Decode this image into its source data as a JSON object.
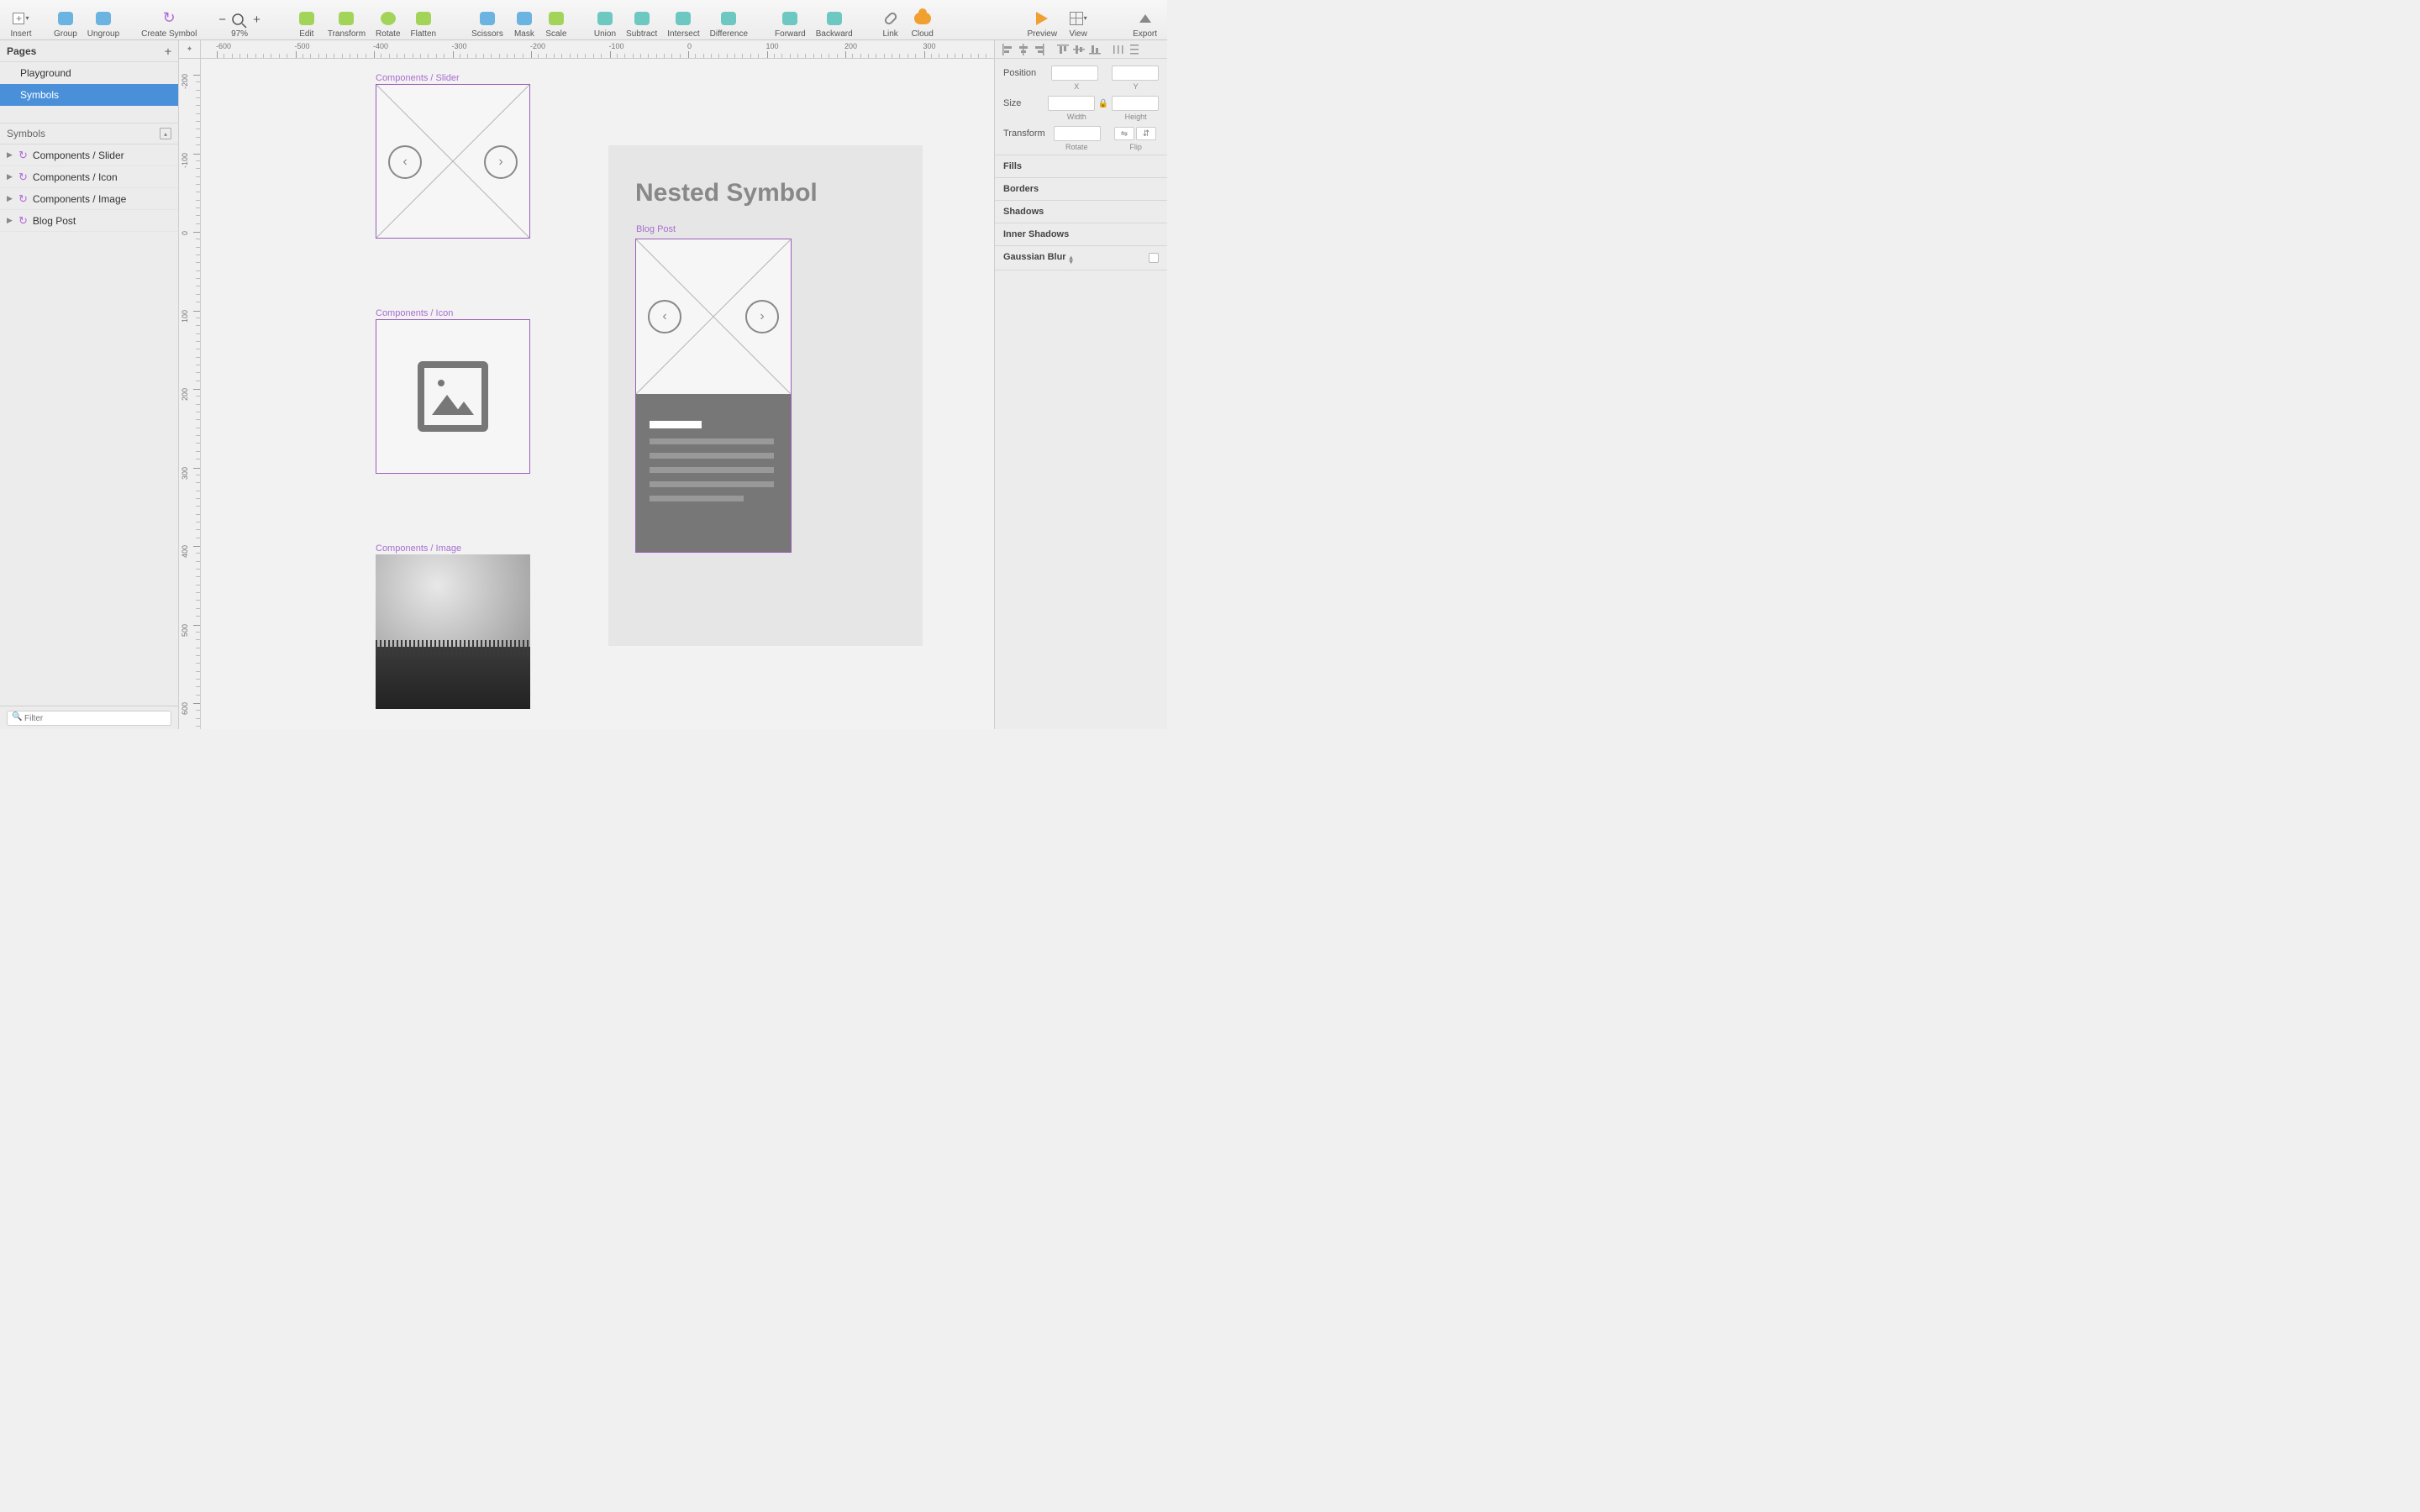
{
  "toolbar": {
    "insert": "Insert",
    "group": "Group",
    "ungroup": "Ungroup",
    "create_symbol": "Create Symbol",
    "zoom": "97%",
    "edit": "Edit",
    "transform": "Transform",
    "rotate": "Rotate",
    "flatten": "Flatten",
    "scissors": "Scissors",
    "mask": "Mask",
    "scale": "Scale",
    "union": "Union",
    "subtract": "Subtract",
    "intersect": "Intersect",
    "difference": "Difference",
    "forward": "Forward",
    "backward": "Backward",
    "link": "Link",
    "cloud": "Cloud",
    "preview": "Preview",
    "view": "View",
    "export": "Export"
  },
  "left": {
    "pages_title": "Pages",
    "pages": [
      {
        "name": "Playground",
        "selected": false
      },
      {
        "name": "Symbols",
        "selected": true
      }
    ],
    "symbols_title": "Symbols",
    "layers": [
      "Components / Slider",
      "Components / Icon",
      "Components / Image",
      "Blog Post"
    ],
    "filter_placeholder": "Filter"
  },
  "canvas": {
    "ruler_h": [
      "-600",
      "-500",
      "-400",
      "-300",
      "-200",
      "-100",
      "0",
      "100",
      "200",
      "300"
    ],
    "ruler_v": [
      "-200",
      "-100",
      "0",
      "100",
      "200",
      "300",
      "400",
      "500",
      "600"
    ],
    "labels": {
      "slider": "Components / Slider",
      "icon": "Components / Icon",
      "image": "Components / Image",
      "blogpost": "Blog Post",
      "heading": "Nested Symbol"
    }
  },
  "right": {
    "position": "Position",
    "x": "X",
    "y": "Y",
    "size": "Size",
    "width": "Width",
    "height": "Height",
    "transform": "Transform",
    "rotate": "Rotate",
    "flip": "Flip",
    "fills": "Fills",
    "borders": "Borders",
    "shadows": "Shadows",
    "inner_shadows": "Inner Shadows",
    "gaussian_blur": "Gaussian Blur"
  }
}
